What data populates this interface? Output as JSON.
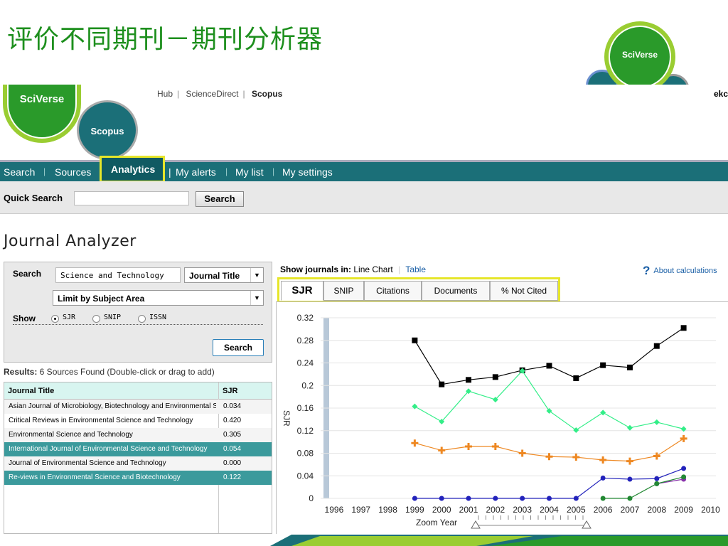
{
  "slide": {
    "title": "评价不同期刊－期刊分析器"
  },
  "logos": {
    "sciverse_top": "SciVerse",
    "sciverse_main": "SciVerse",
    "scopus": "Scopus"
  },
  "header": {
    "links": [
      "Hub",
      "ScienceDirect",
      "Scopus"
    ],
    "user_fragment": "ekc"
  },
  "nav": {
    "items": [
      "Search",
      "Sources",
      "Analytics",
      "My alerts",
      "My list",
      "My settings"
    ],
    "active": "Analytics"
  },
  "quick_search": {
    "label": "Quick Search",
    "value": "",
    "button": "Search"
  },
  "page": {
    "title": "Journal Analyzer"
  },
  "search_panel": {
    "search_label": "Search",
    "query": "Science and Technology",
    "field_select": "Journal Title",
    "subject_select": "Limit by Subject Area",
    "show_label": "Show",
    "options": [
      "SJR",
      "SNIP",
      "ISSN"
    ],
    "selected_option": "SJR",
    "button": "Search"
  },
  "results": {
    "prefix": "Results:",
    "summary": " 6 Sources Found (Double-click or drag to add)",
    "columns": [
      "Journal Title",
      "SJR"
    ],
    "rows": [
      {
        "title": "Asian Journal of Microbiology, Biotechnology and Environmental Sciences",
        "sjr": "0.034",
        "selected": false
      },
      {
        "title": "Critical Reviews in Environmental Science and Technology",
        "sjr": "0.420",
        "selected": false
      },
      {
        "title": "Environmental Science and Technology",
        "sjr": "0.305",
        "selected": false
      },
      {
        "title": "International Journal of Environmental Science and Technology",
        "sjr": "0.054",
        "selected": true
      },
      {
        "title": "Journal of Environmental Science and Technology",
        "sjr": "0.000",
        "selected": false
      },
      {
        "title": "Re-views in Environmental Science and Biotechnology",
        "sjr": "0.122",
        "selected": true
      }
    ]
  },
  "view_toggle": {
    "label": "Show journals in:",
    "active": "Line Chart",
    "other": "Table"
  },
  "about_link": "About calculations",
  "metric_tabs": [
    "SJR",
    "SNIP",
    "Citations",
    "Documents",
    "% Not Cited"
  ],
  "active_metric": "SJR",
  "zoom": {
    "label": "Zoom Year"
  },
  "colors": {
    "brand_green": "#1d8f1d",
    "nav_teal": "#1b6f78",
    "highlight_yellow": "#e6e62a",
    "selected_row": "#3b9a9c",
    "series_black": "#000000",
    "series_green": "#33ee88",
    "series_orange": "#ee8822",
    "series_blue": "#2222bb",
    "series_purple": "#8833aa",
    "series_darkgreen": "#228833"
  },
  "chart_data": {
    "type": "line",
    "ylabel": "SJR",
    "xlabel": "",
    "x": [
      1996,
      1997,
      1998,
      1999,
      2000,
      2001,
      2002,
      2003,
      2004,
      2005,
      2006,
      2007,
      2008,
      2009,
      2010
    ],
    "ylim": [
      0,
      0.32
    ],
    "yticks": [
      "0",
      "0.04",
      "0.08",
      "0.12",
      "0.16",
      "0.2",
      "0.24",
      "0.28",
      "0.32"
    ],
    "grid": true,
    "series": [
      {
        "color": "#000000",
        "marker": "square",
        "points": [
          [
            1999,
            0.28
          ],
          [
            2000,
            0.202
          ],
          [
            2001,
            0.21
          ],
          [
            2002,
            0.215
          ],
          [
            2003,
            0.227
          ],
          [
            2004,
            0.235
          ],
          [
            2005,
            0.213
          ],
          [
            2006,
            0.236
          ],
          [
            2007,
            0.232
          ],
          [
            2008,
            0.27
          ],
          [
            2009,
            0.302
          ]
        ]
      },
      {
        "color": "#33ee88",
        "marker": "diamond",
        "points": [
          [
            1999,
            0.163
          ],
          [
            2000,
            0.136
          ],
          [
            2001,
            0.19
          ],
          [
            2002,
            0.175
          ],
          [
            2003,
            0.226
          ],
          [
            2004,
            0.155
          ],
          [
            2005,
            0.121
          ],
          [
            2006,
            0.152
          ],
          [
            2007,
            0.125
          ],
          [
            2008,
            0.135
          ],
          [
            2009,
            0.123
          ]
        ]
      },
      {
        "color": "#ee8822",
        "marker": "plus",
        "points": [
          [
            1999,
            0.098
          ],
          [
            2000,
            0.085
          ],
          [
            2001,
            0.092
          ],
          [
            2002,
            0.092
          ],
          [
            2003,
            0.08
          ],
          [
            2004,
            0.074
          ],
          [
            2005,
            0.073
          ],
          [
            2006,
            0.068
          ],
          [
            2007,
            0.066
          ],
          [
            2008,
            0.075
          ],
          [
            2009,
            0.106
          ]
        ]
      },
      {
        "color": "#2222bb",
        "marker": "circle",
        "points": [
          [
            1999,
            0
          ],
          [
            2000,
            0
          ],
          [
            2001,
            0
          ],
          [
            2002,
            0
          ],
          [
            2003,
            0
          ],
          [
            2004,
            0
          ],
          [
            2005,
            0
          ],
          [
            2006,
            0.036
          ],
          [
            2007,
            0.034
          ],
          [
            2008,
            0.035
          ],
          [
            2009,
            0.053
          ]
        ]
      },
      {
        "color": "#8833aa",
        "marker": "circle",
        "points": [
          [
            2008,
            0.026
          ],
          [
            2009,
            0.034
          ]
        ]
      },
      {
        "color": "#228833",
        "marker": "circle",
        "points": [
          [
            2006,
            0
          ],
          [
            2007,
            0
          ],
          [
            2008,
            0.026
          ],
          [
            2009,
            0.038
          ]
        ]
      }
    ]
  }
}
